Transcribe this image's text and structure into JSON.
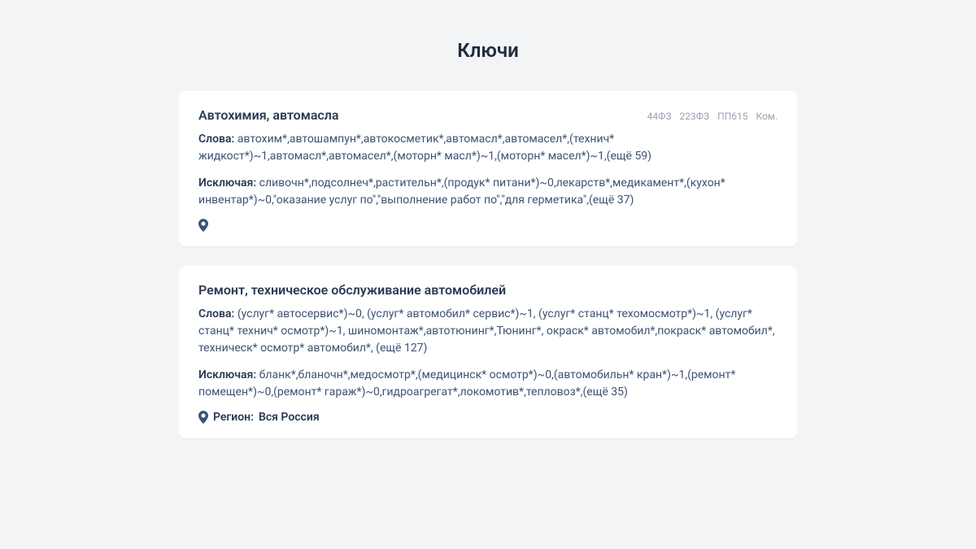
{
  "page_title": "Ключи",
  "labels": {
    "words": "Слова:",
    "exclude": "Исключая:",
    "region": "Регион:"
  },
  "cards": [
    {
      "title": "Автохимия, автомасла",
      "badges": [
        "44ФЗ",
        "223ФЗ",
        "ПП615",
        "Ком."
      ],
      "words": "автохим*,автошампун*,автокосметик*,автомасл*,автомасел*,(технич* жидкост*)~1,автомасл*,автомасел*,(моторн* масл*)~1,(моторн* масел*)~1,(ещё 59)",
      "exclude": "сливочн*,подсолнеч*,растительн*,(продук* питани*)~0,лекарств*,медикамент*,(кухон* инвентар*)~0,\"оказание услуг по\",\"выполнение работ по\",\"для герметика\",(ещё 37)",
      "region": ""
    },
    {
      "title": "Ремонт, техническое обслуживание автомобилей",
      "badges": [],
      "words": "(услуг* автосервис*)~0, (услуг* автомобил* сервис*)~1, (услуг* станц* техомосмотр*)~1, (услуг* станц* технич* осмотр*)~1, шиномонтаж*,автотюнинг*,Тюнинг*, окраск* автомобил*,покраск* автомобил*, техническ* осмотр* автомобил*, (ещё 127)",
      "exclude": "бланк*,бланочн*,медосмотр*,(медицинск* осмотр*)~0,(автомобильн* кран*)~1,(ремонт* помещен*)~0,(ремонт* гараж*)~0,гидроагрегат*,локомотив*,тепловоз*,(ещё 35)",
      "region": "Вся Россия"
    }
  ]
}
